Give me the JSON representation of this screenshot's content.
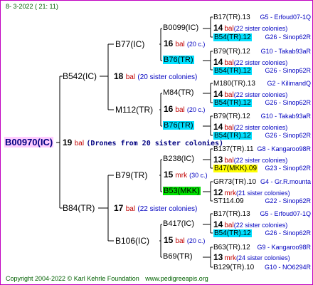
{
  "header": {
    "date": "8-  3-2022 ( 21: 11)"
  },
  "root": {
    "id": "B00970(IC)",
    "number": "19",
    "bal": "bal",
    "note": "(Drones from 20 sister colonies)"
  },
  "gen1": [
    {
      "id": "B542(IC)",
      "number": "18",
      "bal": "bal",
      "sisters": "(20 sister colonies)"
    },
    {
      "id": "B84(TR)",
      "number": "17",
      "bal": "bal",
      "sisters": "(22 sister colonies)"
    }
  ],
  "gen2": [
    {
      "id": "B77(IC)",
      "number": "16",
      "bal": "bal",
      "sisters": "(20 c.)"
    },
    {
      "id": "M112(TR)",
      "number": "16",
      "bal": "bal",
      "sisters": "(20 c.)"
    },
    {
      "id": "B79(TR)",
      "number": "15",
      "bal": "mrk",
      "sisters": "(30 c.)"
    },
    {
      "id": "B106(IC)",
      "number": "15",
      "bal": "bal",
      "sisters": "(20 c.)"
    }
  ],
  "gen3": [
    {
      "id": "B0099(IC)"
    },
    {
      "id": "B76(TR)"
    },
    {
      "id": "M84(TR)"
    },
    {
      "id": "B76(TR)"
    },
    {
      "id": "B238(IC)"
    },
    {
      "id": "B53(MKK)"
    },
    {
      "id": "B417(IC)"
    },
    {
      "id": "B69(TR)"
    }
  ],
  "gen4": [
    {
      "id": "B17(TR).13",
      "code": "G5 - Erfoud07-1Q",
      "hl": ""
    },
    {
      "id": "14",
      "bal": "bal",
      "sisters": "(22 sister colonies)",
      "type": "info"
    },
    {
      "id": "B54(TR).12",
      "code": "G26 - Sinop62R",
      "hl": "cyan"
    },
    {
      "id": "B79(TR).12",
      "code": "G10 - Takab93aR",
      "hl": ""
    },
    {
      "id": "14",
      "bal": "bal",
      "sisters": "(22 sister colonies)",
      "type": "info"
    },
    {
      "id": "B54(TR).12",
      "code": "G26 - Sinop62R",
      "hl": "cyan"
    },
    {
      "id": "M180(TR).13",
      "code": "G2 - KilimandQ",
      "hl": ""
    },
    {
      "id": "14",
      "bal": "bal",
      "sisters": "(22 sister colonies)",
      "type": "info"
    },
    {
      "id": "B54(TR).12",
      "code": "G26 - Sinop62R",
      "hl": "cyan"
    },
    {
      "id": "B79(TR).12",
      "code": "G10 - Takab93aR",
      "hl": ""
    },
    {
      "id": "14",
      "bal": "bal",
      "sisters": "(22 sister colonies)",
      "type": "info"
    },
    {
      "id": "B54(TR).12",
      "code": "G26 - Sinop62R",
      "hl": "cyan"
    },
    {
      "id": "B137(TR).11",
      "code": "G8 - Kangaroo98R",
      "hl": ""
    },
    {
      "id": "13",
      "bal": "bal",
      "sisters": "(22 sister colonies)",
      "type": "info"
    },
    {
      "id": "B47(MKK).09",
      "code": "G23 - Sinop62R",
      "hl": "yellow"
    },
    {
      "id": "GR73(TR).10",
      "code": "G4 - Gr.R.mounta",
      "hl": ""
    },
    {
      "id": "12",
      "bal": "mrk",
      "sisters": "(21 sister colonies)",
      "type": "info"
    },
    {
      "id": "ST114.09",
      "code": "G22 - Sinop62R",
      "hl": ""
    },
    {
      "id": "B17(TR).13",
      "code": "G5 - Erfoud07-1Q",
      "hl": ""
    },
    {
      "id": "14",
      "bal": "bal",
      "sisters": "(22 sister colonies)",
      "type": "info"
    },
    {
      "id": "B54(TR).12",
      "code": "G26 - Sinop62R",
      "hl": "cyan"
    },
    {
      "id": "B63(TR).12",
      "code": "G9 - Kangaroo98R",
      "hl": ""
    },
    {
      "id": "13",
      "bal": "mrk",
      "sisters": "(24 sister colonies)",
      "type": "info"
    },
    {
      "id": "B129(TR).10",
      "code": "G10 - NO6294R",
      "hl": ""
    }
  ],
  "footer": {
    "copyright": "Copyright 2004-2022 © Karl Kehrle Foundation",
    "site": "www.pedigreeapis.org"
  }
}
